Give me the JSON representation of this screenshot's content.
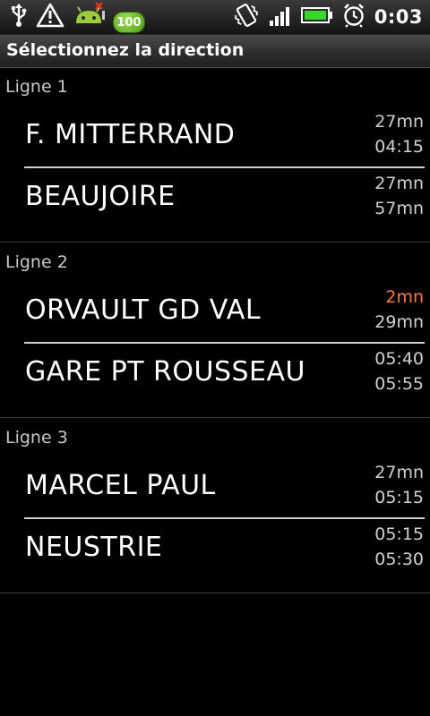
{
  "status_bar": {
    "left_icons": [
      "usb-icon",
      "warning-icon",
      "android-debug-icon"
    ],
    "badge": "100",
    "right_icons": [
      "vibrate-icon",
      "signal-icon",
      "battery-icon",
      "alarm-icon"
    ],
    "time": "0:03"
  },
  "header": {
    "title": "Sélectionnez la direction"
  },
  "colors": {
    "accent": "#ff7a3c",
    "time_default": "#d0d0d0"
  },
  "sections": [
    {
      "label": "Ligne 1",
      "directions": [
        {
          "name": "F. MITTERRAND",
          "time1": "27mn",
          "time2": "04:15"
        },
        {
          "name": "BEAUJOIRE",
          "time1": "27mn",
          "time2": "57mn"
        }
      ]
    },
    {
      "label": "Ligne 2",
      "directions": [
        {
          "name": "ORVAULT GD VAL",
          "time1": "2mn",
          "time2": "29mn"
        },
        {
          "name": "GARE PT ROUSSEAU",
          "time1": "05:40",
          "time2": "05:55"
        }
      ]
    },
    {
      "label": "Ligne 3",
      "directions": [
        {
          "name": "MARCEL PAUL",
          "time1": "27mn",
          "time2": "05:15"
        },
        {
          "name": "NEUSTRIE",
          "time1": "05:15",
          "time2": "05:30"
        }
      ]
    }
  ]
}
